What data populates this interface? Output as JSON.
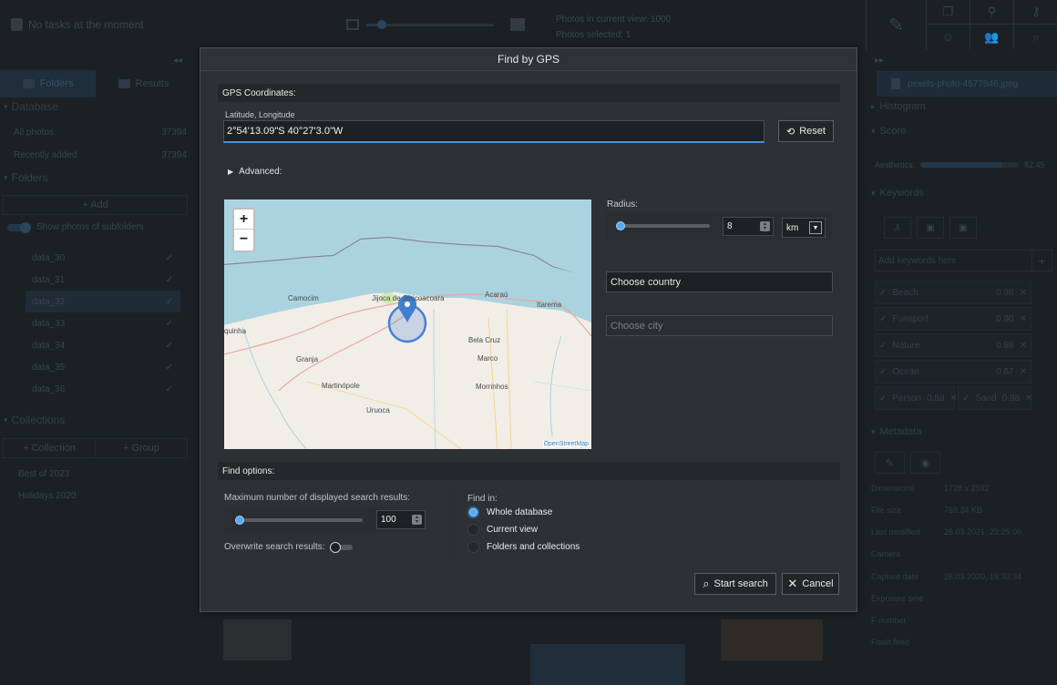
{
  "background": {
    "tasks_status": "No tasks at the moment",
    "photos_in_view": "Photos in current view: 1000",
    "photos_selected": "Photos selected: 1",
    "left_panel": {
      "tabs": [
        {
          "label": "Folders"
        },
        {
          "label": "Results"
        }
      ],
      "database_header": "Database",
      "database_items": [
        {
          "label": "All photos",
          "count": "37394"
        },
        {
          "label": "Recently added",
          "count": "37394"
        }
      ],
      "folders_header": "Folders",
      "add_label": "+ Add",
      "show_subfolders_label": "Show photos of subfolders",
      "folders": [
        "data_30",
        "data_31",
        "data_32",
        "data_33",
        "data_34",
        "data_35",
        "data_36"
      ],
      "selected_folder": "data_32",
      "collections_header": "Collections",
      "add_collection_label": "+ Collection",
      "add_group_label": "+ Group",
      "collections": [
        "Best of 2023",
        "Holidays 2020"
      ]
    },
    "right_panel": {
      "file_name": "pexels-photo-4577846.jpeg",
      "histogram_header": "Histogram",
      "score_header": "Score",
      "aesthetics_label": "Aesthetics:",
      "aesthetics_value": "82.45",
      "aesthetics_fraction": 0.8245,
      "keywords_header": "Keywords",
      "add_keywords_placeholder": "Add keywords here",
      "keywords": [
        {
          "name": "Beach",
          "score": "0.98"
        },
        {
          "name": "Funsport",
          "score": "0.90"
        },
        {
          "name": "Nature",
          "score": "0.98"
        },
        {
          "name": "Ocean",
          "score": "0.67"
        },
        {
          "name": "Person",
          "score": "0.88"
        },
        {
          "name": "Sand",
          "score": "0.98"
        }
      ],
      "metadata_header": "Metadata",
      "metadata": [
        {
          "key": "Dimensions",
          "value": "1728 x 2592"
        },
        {
          "key": "File size",
          "value": "759.34 KB"
        },
        {
          "key": "Last modified",
          "value": "26.03.2021, 23:25:06"
        },
        {
          "key": "Camera",
          "value": ""
        },
        {
          "key": "Capture date",
          "value": "26.03.2020, 18:33:34"
        },
        {
          "key": "Exposure time",
          "value": ""
        },
        {
          "key": "F number",
          "value": ""
        },
        {
          "key": "Flash fired",
          "value": ""
        }
      ]
    }
  },
  "dialog": {
    "title": "Find by GPS",
    "gps_section": "GPS Coordinates:",
    "coord_label": "Latitude, Longitude",
    "coord_value": "2°54'13.09\"S 40°27'3.0\"W",
    "reset_label": "Reset",
    "advanced_label": "Advanced:",
    "map": {
      "attribution": "OpenStreetMap",
      "zoom_in": "+",
      "zoom_out": "−",
      "places": [
        "Camocim",
        "Jijoca de Jericoacoara",
        "Acaraú",
        "Itarema",
        "quinha",
        "Bela Cruz",
        "Granja",
        "Marco",
        "Martinópole",
        "Morrinhos",
        "Uruoca"
      ]
    },
    "radius_label": "Radius:",
    "radius_value": "8",
    "radius_unit": "km",
    "radius_fraction": 0.02,
    "country_value": "Choose country",
    "city_placeholder": "Choose city",
    "find_options_section": "Find options:",
    "max_results_label": "Maximum number of displayed search results:",
    "max_results_value": "100",
    "overwrite_label": "Overwrite search results:",
    "overwrite_on": false,
    "find_in_label": "Find in:",
    "find_in_options": [
      {
        "label": "Whole database",
        "selected": true
      },
      {
        "label": "Current view",
        "selected": false
      },
      {
        "label": "Folders and collections",
        "selected": false
      }
    ],
    "start_search_label": "Start search",
    "cancel_label": "Cancel"
  },
  "colors": {
    "accent": "#5aa9f2",
    "dialog_bg": "#2d3135",
    "app_bg": "#1b2024"
  }
}
